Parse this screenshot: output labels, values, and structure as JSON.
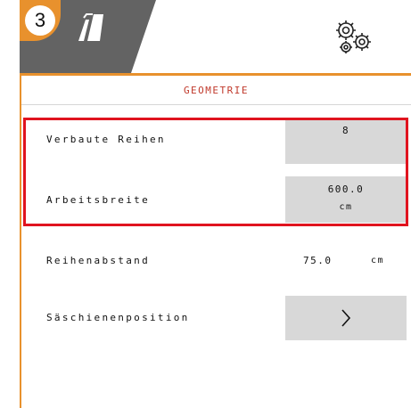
{
  "header": {
    "step_number": "3",
    "machine_icon": "seeder-frame-icon",
    "settings_icon": "gears-icon",
    "accent_color": "#e8912d",
    "header_color": "#636363"
  },
  "page": {
    "title": "GEOMETRIE"
  },
  "rows": {
    "verbaute_reihen": {
      "label": "Verbaute Reihen",
      "value": "8"
    },
    "arbeitsbreite": {
      "label": "Arbeitsbreite",
      "value": "600.0",
      "unit": "cm"
    },
    "reihenabstand": {
      "label": "Reihenabstand",
      "value": "75.0",
      "unit": "cm"
    },
    "saeschienenposition": {
      "label": "Säschienenposition"
    }
  },
  "highlight_color": "#e0141f"
}
